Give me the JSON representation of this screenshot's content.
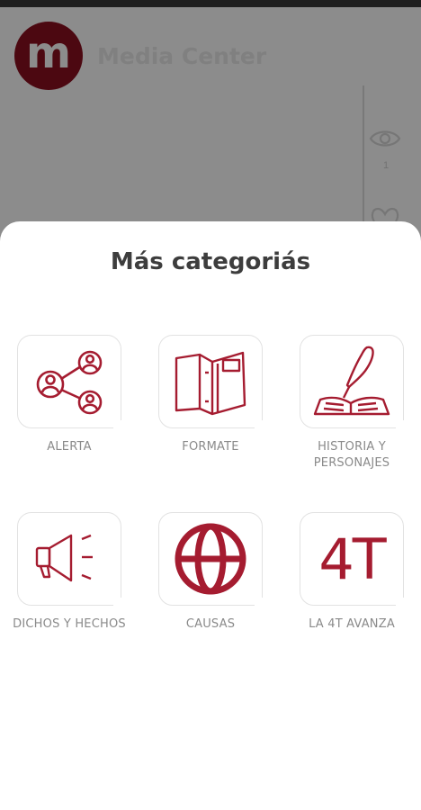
{
  "app": {
    "logo_letter": "m",
    "title": "Media Center",
    "eye_count": "1"
  },
  "sheet": {
    "title": "Más categoriás",
    "categories": [
      {
        "label": "ALERTA",
        "icon": "share-network-icon"
      },
      {
        "label": "FORMATE",
        "icon": "book-icon"
      },
      {
        "label": "HISTORIA Y PERSONAJES",
        "icon": "quill-book-icon"
      },
      {
        "label": "DICHOS Y HECHOS",
        "icon": "megaphone-icon"
      },
      {
        "label": "CAUSAS",
        "icon": "globe-icon"
      },
      {
        "label": "LA 4T AVANZA",
        "icon": "4t-icon",
        "icon_text": "4T"
      }
    ]
  },
  "colors": {
    "accent": "#a51c30",
    "logo_bg": "#8b1020",
    "label": "#8a8a8a",
    "title": "#3d3d3d"
  }
}
